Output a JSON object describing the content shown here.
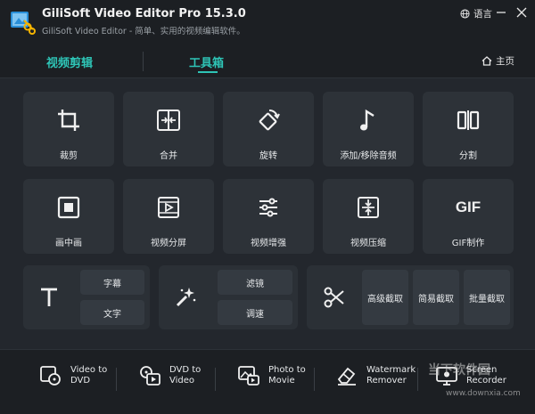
{
  "app": {
    "title": "GiliSoft Video Editor Pro 15.3.0",
    "subtitle": "GiliSoft Video Editor - 简单、实用的视频编辑软件。",
    "language": "语言"
  },
  "tabs": {
    "edit": "视频剪辑",
    "toolbox": "工具箱",
    "home": "主页"
  },
  "tools": [
    {
      "label": "裁剪",
      "icon": "crop-icon"
    },
    {
      "label": "合并",
      "icon": "merge-icon"
    },
    {
      "label": "旋转",
      "icon": "rotate-icon"
    },
    {
      "label": "添加/移除音频",
      "icon": "music-note-icon"
    },
    {
      "label": "分割",
      "icon": "split-icon"
    },
    {
      "label": "画中画",
      "icon": "picture-in-picture-icon"
    },
    {
      "label": "视频分屏",
      "icon": "split-screen-icon"
    },
    {
      "label": "视频增强",
      "icon": "sliders-icon"
    },
    {
      "label": "视频压缩",
      "icon": "compress-icon"
    },
    {
      "label": "GIF制作",
      "icon": "gif-icon"
    }
  ],
  "text_group": {
    "subtitle": "字幕",
    "text": "文字"
  },
  "filter_group": {
    "filter": "滤镜",
    "adjust": "调速"
  },
  "cut_group": {
    "advanced": "高级截取",
    "simple": "简易截取",
    "batch": "批量截取"
  },
  "gif_text": "GIF",
  "bottom": [
    {
      "line1": "Video to",
      "line2": "DVD"
    },
    {
      "line1": "DVD to",
      "line2": "Video"
    },
    {
      "line1": "Photo to",
      "line2": "Movie"
    },
    {
      "line1": "Watermark",
      "line2": "Remover"
    },
    {
      "line1": "Screen",
      "line2": "Recorder"
    }
  ],
  "watermark": {
    "brand": "当下软件园",
    "url": "www.downxia.com"
  },
  "colors": {
    "accent": "#2ec4b6",
    "background": "#23272d",
    "tile": "#2d3238"
  }
}
